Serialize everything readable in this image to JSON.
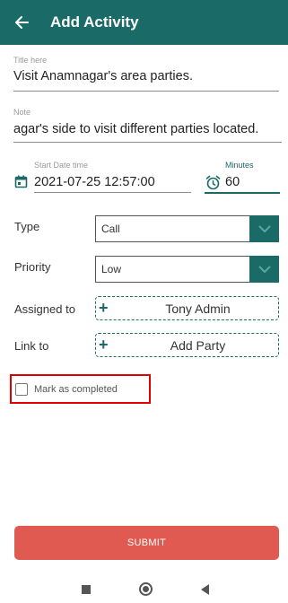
{
  "app_bar": {
    "title": "Add Activity",
    "back_icon": "arrow-left-icon",
    "background_color": "#1a6b67"
  },
  "form": {
    "title": {
      "label": "Title here",
      "value_prefix": "Visit ",
      "value_misspelled": "Anamnagar's",
      "value_suffix": " area parties."
    },
    "note": {
      "label": "Note",
      "value": "agar's side to visit different parties located."
    },
    "start_date": {
      "label": "Start Date time",
      "value": "2021-07-25 12:57:00",
      "icon": "calendar-icon"
    },
    "minutes": {
      "label": "Minutes",
      "value": "60",
      "icon": "alarm-clock-icon"
    },
    "type": {
      "label": "Type",
      "value": "Call",
      "icon": "chevron-down-icon"
    },
    "priority": {
      "label": "Priority",
      "value": "Low",
      "icon": "chevron-down-icon"
    },
    "assigned_to": {
      "label": "Assigned to",
      "value": "Tony Admin",
      "icon": "plus-icon"
    },
    "link_to": {
      "label": "Link to",
      "value": "Add Party",
      "icon": "plus-icon"
    },
    "completed": {
      "label": "Mark as completed",
      "checked": false
    }
  },
  "submit_label": "SUBMIT",
  "colors": {
    "primary": "#1a6b67",
    "submit": "#e05a52",
    "highlight": "#e00000"
  },
  "system_nav": {
    "icons": [
      "recent-apps-icon",
      "home-icon",
      "back-icon"
    ]
  }
}
